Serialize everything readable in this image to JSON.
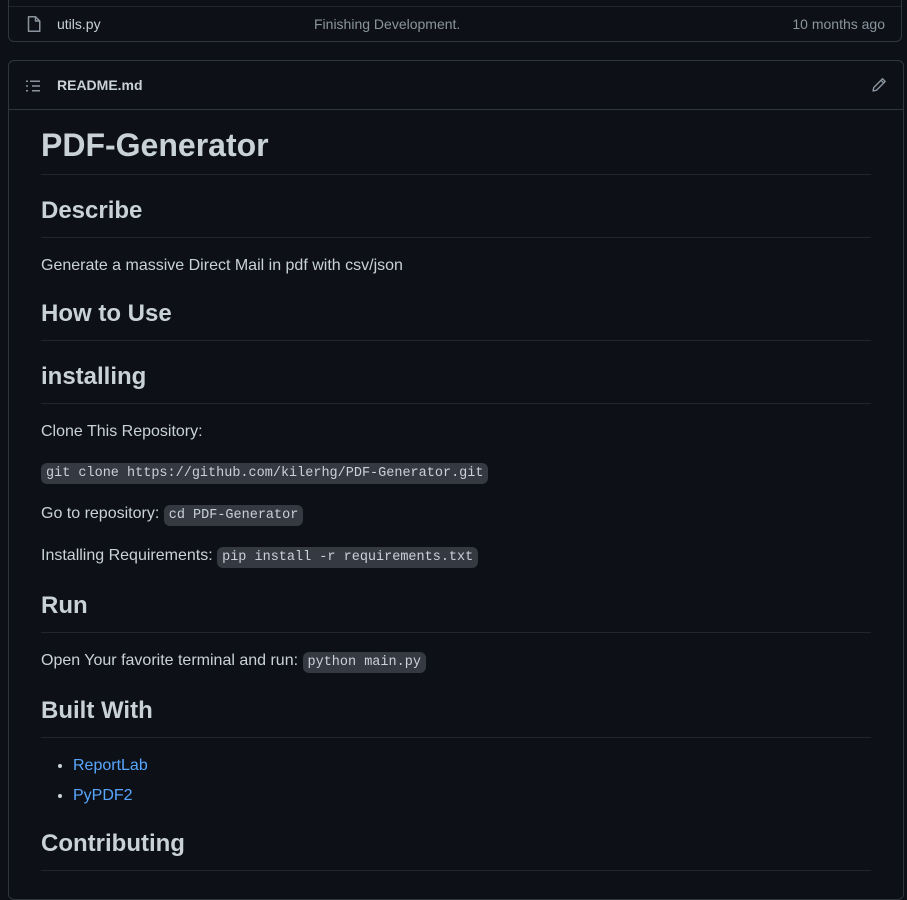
{
  "file_row": {
    "name": "utils.py",
    "commit": "Finishing Development.",
    "age": "10 months ago",
    "icon": "file-icon"
  },
  "readme": {
    "filename": "README.md",
    "title": "PDF-Generator",
    "describe_heading": "Describe",
    "describe_text": "Generate a massive Direct Mail in pdf with csv/json",
    "how_heading": "How to Use",
    "installing_heading": "installing",
    "clone_text": "Clone This Repository:",
    "clone_code": "git clone https://github.com/kilerhg/PDF-Generator.git",
    "goto_text": "Go to repository: ",
    "goto_code": "cd PDF-Generator",
    "req_text": "Installing Requirements: ",
    "req_code": "pip install -r requirements.txt",
    "run_heading": "Run",
    "run_text": "Open Your favorite terminal and run: ",
    "run_code": "python main.py",
    "built_heading": "Built With",
    "built_items": [
      "ReportLab",
      "PyPDF2"
    ],
    "contrib_heading": "Contributing"
  },
  "colors": {
    "background": "#0d1117",
    "text": "#c9d1d9",
    "muted": "#8b949e",
    "link": "#58a6ff",
    "border": "#30363d"
  }
}
